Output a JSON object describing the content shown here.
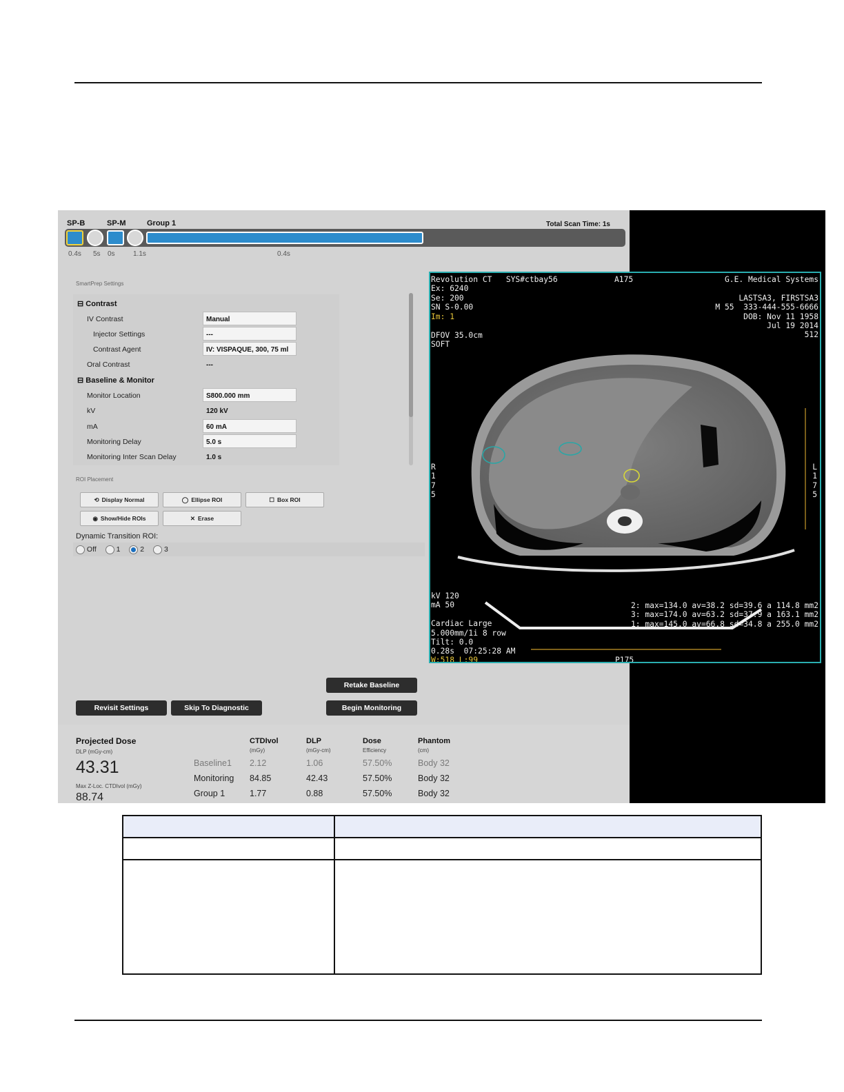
{
  "timeline": {
    "labels": [
      "SP-B",
      "SP-M",
      "Group 1"
    ],
    "total_scan_time": "Total Scan Time: 1s",
    "times": [
      "0.4s",
      "5s",
      "0s",
      "1.1s",
      "0.4s"
    ]
  },
  "settings": {
    "heading": "SmartPrep Settings",
    "contrast_title": "Contrast",
    "rows_contrast": [
      {
        "label": "IV Contrast",
        "value": "Manual"
      },
      {
        "label": "Injector Settings",
        "value": "---"
      },
      {
        "label": "Contrast Agent",
        "value": "IV: VISPAQUE, 300, 75 ml"
      },
      {
        "label": "Oral Contrast",
        "value": "---"
      }
    ],
    "baseline_title": "Baseline & Monitor",
    "rows_baseline": [
      {
        "label": "Monitor Location",
        "value": "S800.000 mm"
      },
      {
        "label": "kV",
        "value": "120 kV"
      },
      {
        "label": "mA",
        "value": "60 mA"
      },
      {
        "label": "Monitoring Delay",
        "value": "5.0 s"
      },
      {
        "label": "Monitoring Inter Scan Delay",
        "value": "1.0 s"
      }
    ]
  },
  "roi": {
    "heading": "ROI Placement",
    "display_normal": "Display Normal",
    "ellipse_roi": "Ellipse ROI",
    "box_roi": "Box ROI",
    "show_hide": "Show/Hide ROIs",
    "erase": "Erase",
    "dynamic_label": "Dynamic Transition ROI:",
    "options": [
      "Off",
      "1",
      "2",
      "3"
    ],
    "selected": "2"
  },
  "buttons": {
    "retake_baseline": "Retake Baseline",
    "revisit_settings": "Revisit Settings",
    "skip_diagnostic": "Skip To Diagnostic",
    "begin_monitoring": "Begin Monitoring"
  },
  "dose": {
    "projected_title": "Projected Dose",
    "dlp_unit": "DLP (mGy-cm)",
    "dlp_value": "43.31",
    "max_label": "Max Z-Loc. CTDIvol (mGy)",
    "max_value": "88.74",
    "columns": [
      {
        "title": "CTDIvol",
        "sub": "(mGy)"
      },
      {
        "title": "DLP",
        "sub": "(mGy-cm)"
      },
      {
        "title": "Dose",
        "sub": "Efficiency"
      },
      {
        "title": "Phantom",
        "sub": "(cm)"
      }
    ],
    "rows": [
      {
        "name": "Baseline1",
        "ctdi": "2.12",
        "dlp": "1.06",
        "eff": "57.50%",
        "phantom": "Body 32"
      },
      {
        "name": "Monitoring",
        "ctdi": "84.85",
        "dlp": "42.43",
        "eff": "57.50%",
        "phantom": "Body 32"
      },
      {
        "name": "Group 1",
        "ctdi": "1.77",
        "dlp": "0.88",
        "eff": "57.50%",
        "phantom": "Body 32"
      }
    ]
  },
  "ct_overlay": {
    "top_left": "Revolution CT   SYS#ctbay56\nEx: 6240\nSe: 200\nSN S-0.00",
    "image_num": "Im: 1",
    "dfov": "DFOV 35.0cm\nSOFT",
    "top_center": "A175",
    "top_right": "G.E. Medical Systems\n\nLASTSA3, FIRSTSA3\nM 55  333-444-555-6666\nDOB: Nov 11 1958\nJul 19 2014\n512",
    "left_marker": "R\n1\n7\n5",
    "right_marker": "L\n1\n7\n5",
    "bottom_left": "kV 120\nmA 50\n\nCardiac Large\n5.000mm/1i 8 row\nTilt: 0.0\n0.28s  07:25:28 AM",
    "window_level": "W:518 L:99",
    "bottom_center": "P175",
    "roi_stats": "2: max=134.0 av=38.2 sd=39.6 a 114.8 mm2\n3: max=174.0 av=63.2 sd=37.9 a 163.1 mm2\n1: max=145.0 av=66.8 sd=34.8 a 255.0 mm2"
  },
  "colors": {
    "timeline_blue": "#2d8ccc",
    "ct_border": "#2aaeb0",
    "roi1": "#2aa6a6",
    "roi2": "#2aa6a6",
    "roi3": "#d8d838",
    "overlay_yellow": "#e8c73a"
  }
}
